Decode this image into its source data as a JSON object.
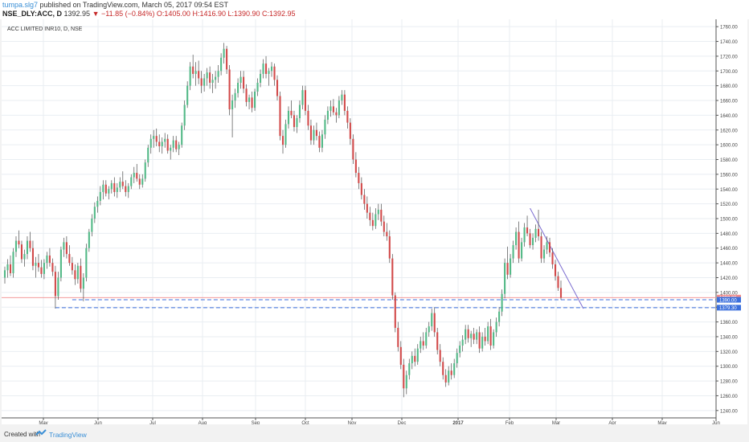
{
  "header": {
    "author": "tumpa.slg7",
    "published_text": "published on TradingView.com, March 05, 2017 09:54 EST",
    "symbol": "NSE_DLY:ACC, D",
    "last": "1392.95",
    "change": "▼ −11.85 (−0.84%)",
    "ohlc": "O:1405.00 H:1416.90 L:1390.90 C:1392.95"
  },
  "footer": {
    "created_with": "Created with",
    "brand": "TradingView"
  },
  "chart_data": {
    "type": "candlestick",
    "title": "ACC LIMITED INR10, D, NSE",
    "y_axis": {
      "min": 1230,
      "max": 1770,
      "ticks": [
        1240,
        1260,
        1280,
        1300,
        1320,
        1340,
        1360,
        1380,
        1400,
        1420,
        1440,
        1460,
        1480,
        1500,
        1520,
        1540,
        1560,
        1580,
        1600,
        1620,
        1640,
        1660,
        1680,
        1700,
        1720,
        1740,
        1760
      ],
      "tick_labels": [
        "1240.00",
        "1260.00",
        "1280.00",
        "1300.00",
        "1320.00",
        "1340.00",
        "1360.00",
        "1380.00",
        "1400.00",
        "1420.00",
        "1440.00",
        "1460.00",
        "1480.00",
        "1500.00",
        "1520.00",
        "1540.00",
        "1560.00",
        "1580.00",
        "1600.00",
        "1620.00",
        "1640.00",
        "1660.00",
        "1680.00",
        "1700.00",
        "1720.00",
        "1740.00",
        "1760.00"
      ]
    },
    "x_axis": {
      "labels": [
        "May",
        "Jun",
        "Jul",
        "Aug",
        "Sep",
        "Oct",
        "Nov",
        "Dec",
        "2017",
        "Feb",
        "Mar",
        "Apr",
        "May",
        "Jun"
      ],
      "bold": "2017"
    },
    "grid": true,
    "colors": {
      "up": "#53b987",
      "down": "#d24a4a",
      "wick": "#4d4d4d",
      "grid": "#e9eef2",
      "trendline": "#7b6cd0",
      "level": "#3b6fdc",
      "last_price": "#f28b8b"
    },
    "candles": [
      [
        1420,
        1435,
        1412,
        1430
      ],
      [
        1430,
        1445,
        1420,
        1438
      ],
      [
        1438,
        1450,
        1422,
        1426
      ],
      [
        1426,
        1460,
        1420,
        1455
      ],
      [
        1455,
        1476,
        1448,
        1470
      ],
      [
        1470,
        1484,
        1460,
        1465
      ],
      [
        1465,
        1470,
        1440,
        1445
      ],
      [
        1445,
        1458,
        1435,
        1452
      ],
      [
        1452,
        1476,
        1445,
        1470
      ],
      [
        1470,
        1482,
        1455,
        1460
      ],
      [
        1460,
        1470,
        1430,
        1436
      ],
      [
        1436,
        1448,
        1420,
        1440
      ],
      [
        1440,
        1452,
        1428,
        1434
      ],
      [
        1434,
        1444,
        1420,
        1425
      ],
      [
        1425,
        1445,
        1418,
        1440
      ],
      [
        1440,
        1455,
        1432,
        1450
      ],
      [
        1450,
        1460,
        1435,
        1440
      ],
      [
        1440,
        1446,
        1422,
        1428
      ],
      [
        1428,
        1436,
        1378,
        1395
      ],
      [
        1395,
        1428,
        1390,
        1420
      ],
      [
        1420,
        1462,
        1415,
        1458
      ],
      [
        1458,
        1474,
        1448,
        1468
      ],
      [
        1468,
        1476,
        1446,
        1452
      ],
      [
        1452,
        1464,
        1436,
        1440
      ],
      [
        1440,
        1448,
        1424,
        1430
      ],
      [
        1430,
        1438,
        1410,
        1418
      ],
      [
        1418,
        1440,
        1412,
        1436
      ],
      [
        1436,
        1446,
        1400,
        1405
      ],
      [
        1405,
        1426,
        1388,
        1420
      ],
      [
        1420,
        1466,
        1415,
        1460
      ],
      [
        1460,
        1486,
        1455,
        1482
      ],
      [
        1482,
        1506,
        1476,
        1500
      ],
      [
        1500,
        1522,
        1494,
        1516
      ],
      [
        1516,
        1530,
        1508,
        1524
      ],
      [
        1524,
        1544,
        1518,
        1536
      ],
      [
        1536,
        1552,
        1526,
        1546
      ],
      [
        1546,
        1552,
        1530,
        1534
      ],
      [
        1534,
        1544,
        1526,
        1540
      ],
      [
        1540,
        1552,
        1534,
        1548
      ],
      [
        1548,
        1556,
        1530,
        1536
      ],
      [
        1536,
        1548,
        1528,
        1542
      ],
      [
        1542,
        1556,
        1536,
        1550
      ],
      [
        1550,
        1564,
        1540,
        1544
      ],
      [
        1544,
        1552,
        1530,
        1536
      ],
      [
        1536,
        1548,
        1528,
        1544
      ],
      [
        1544,
        1560,
        1540,
        1556
      ],
      [
        1556,
        1570,
        1548,
        1562
      ],
      [
        1562,
        1574,
        1550,
        1554
      ],
      [
        1554,
        1560,
        1540,
        1546
      ],
      [
        1546,
        1560,
        1542,
        1554
      ],
      [
        1554,
        1580,
        1550,
        1576
      ],
      [
        1576,
        1600,
        1570,
        1596
      ],
      [
        1596,
        1614,
        1588,
        1608
      ],
      [
        1608,
        1620,
        1596,
        1612
      ],
      [
        1612,
        1622,
        1598,
        1604
      ],
      [
        1604,
        1614,
        1590,
        1598
      ],
      [
        1598,
        1610,
        1588,
        1604
      ],
      [
        1604,
        1616,
        1596,
        1608
      ],
      [
        1608,
        1614,
        1588,
        1592
      ],
      [
        1592,
        1600,
        1580,
        1596
      ],
      [
        1596,
        1612,
        1590,
        1606
      ],
      [
        1606,
        1612,
        1590,
        1594
      ],
      [
        1594,
        1604,
        1586,
        1600
      ],
      [
        1600,
        1630,
        1596,
        1626
      ],
      [
        1626,
        1660,
        1620,
        1654
      ],
      [
        1654,
        1686,
        1650,
        1680
      ],
      [
        1680,
        1712,
        1674,
        1706
      ],
      [
        1706,
        1722,
        1690,
        1696
      ],
      [
        1696,
        1712,
        1680,
        1700
      ],
      [
        1700,
        1714,
        1682,
        1690
      ],
      [
        1690,
        1700,
        1670,
        1680
      ],
      [
        1680,
        1696,
        1672,
        1690
      ],
      [
        1690,
        1704,
        1680,
        1698
      ],
      [
        1698,
        1706,
        1676,
        1684
      ],
      [
        1684,
        1696,
        1670,
        1688
      ],
      [
        1688,
        1700,
        1676,
        1692
      ],
      [
        1692,
        1708,
        1684,
        1700
      ],
      [
        1700,
        1724,
        1694,
        1718
      ],
      [
        1718,
        1738,
        1710,
        1730
      ],
      [
        1730,
        1734,
        1696,
        1702
      ],
      [
        1702,
        1708,
        1640,
        1648
      ],
      [
        1648,
        1668,
        1610,
        1660
      ],
      [
        1660,
        1676,
        1650,
        1670
      ],
      [
        1670,
        1690,
        1664,
        1684
      ],
      [
        1684,
        1700,
        1676,
        1692
      ],
      [
        1692,
        1700,
        1670,
        1676
      ],
      [
        1676,
        1682,
        1652,
        1658
      ],
      [
        1658,
        1668,
        1648,
        1664
      ],
      [
        1664,
        1672,
        1644,
        1650
      ],
      [
        1650,
        1676,
        1646,
        1672
      ],
      [
        1672,
        1690,
        1666,
        1684
      ],
      [
        1684,
        1702,
        1678,
        1696
      ],
      [
        1696,
        1716,
        1690,
        1710
      ],
      [
        1710,
        1720,
        1690,
        1696
      ],
      [
        1696,
        1704,
        1680,
        1700
      ],
      [
        1700,
        1712,
        1692,
        1706
      ],
      [
        1706,
        1710,
        1680,
        1688
      ],
      [
        1688,
        1694,
        1660,
        1666
      ],
      [
        1666,
        1672,
        1606,
        1612
      ],
      [
        1612,
        1620,
        1588,
        1600
      ],
      [
        1600,
        1634,
        1596,
        1628
      ],
      [
        1628,
        1652,
        1622,
        1646
      ],
      [
        1646,
        1660,
        1636,
        1640
      ],
      [
        1640,
        1646,
        1618,
        1624
      ],
      [
        1624,
        1640,
        1616,
        1636
      ],
      [
        1636,
        1660,
        1630,
        1654
      ],
      [
        1654,
        1680,
        1648,
        1674
      ],
      [
        1674,
        1680,
        1640,
        1646
      ],
      [
        1646,
        1654,
        1620,
        1626
      ],
      [
        1626,
        1634,
        1600,
        1606
      ],
      [
        1606,
        1626,
        1600,
        1620
      ],
      [
        1620,
        1630,
        1606,
        1612
      ],
      [
        1612,
        1618,
        1590,
        1596
      ],
      [
        1596,
        1620,
        1590,
        1614
      ],
      [
        1614,
        1640,
        1608,
        1634
      ],
      [
        1634,
        1652,
        1628,
        1646
      ],
      [
        1646,
        1660,
        1638,
        1652
      ],
      [
        1652,
        1662,
        1640,
        1644
      ],
      [
        1644,
        1650,
        1630,
        1640
      ],
      [
        1640,
        1666,
        1636,
        1660
      ],
      [
        1660,
        1674,
        1654,
        1668
      ],
      [
        1668,
        1674,
        1640,
        1646
      ],
      [
        1646,
        1652,
        1622,
        1630
      ],
      [
        1630,
        1636,
        1600,
        1608
      ],
      [
        1608,
        1614,
        1574,
        1580
      ],
      [
        1580,
        1590,
        1556,
        1562
      ],
      [
        1562,
        1570,
        1540,
        1548
      ],
      [
        1548,
        1556,
        1526,
        1532
      ],
      [
        1532,
        1540,
        1512,
        1520
      ],
      [
        1520,
        1530,
        1500,
        1508
      ],
      [
        1508,
        1516,
        1490,
        1498
      ],
      [
        1498,
        1508,
        1484,
        1490
      ],
      [
        1490,
        1514,
        1486,
        1506
      ],
      [
        1506,
        1520,
        1498,
        1512
      ],
      [
        1512,
        1520,
        1490,
        1496
      ],
      [
        1496,
        1504,
        1476,
        1482
      ],
      [
        1482,
        1494,
        1470,
        1476
      ],
      [
        1476,
        1484,
        1440,
        1446
      ],
      [
        1446,
        1452,
        1390,
        1396
      ],
      [
        1396,
        1400,
        1346,
        1352
      ],
      [
        1352,
        1360,
        1320,
        1326
      ],
      [
        1326,
        1334,
        1296,
        1302
      ],
      [
        1302,
        1310,
        1258,
        1270
      ],
      [
        1270,
        1294,
        1262,
        1288
      ],
      [
        1288,
        1310,
        1282,
        1304
      ],
      [
        1304,
        1320,
        1296,
        1314
      ],
      [
        1314,
        1324,
        1300,
        1306
      ],
      [
        1306,
        1330,
        1302,
        1324
      ],
      [
        1324,
        1340,
        1318,
        1334
      ],
      [
        1334,
        1346,
        1322,
        1328
      ],
      [
        1328,
        1352,
        1324,
        1346
      ],
      [
        1346,
        1360,
        1340,
        1354
      ],
      [
        1354,
        1378,
        1348,
        1372
      ],
      [
        1372,
        1380,
        1340,
        1346
      ],
      [
        1346,
        1352,
        1316,
        1322
      ],
      [
        1322,
        1330,
        1300,
        1306
      ],
      [
        1306,
        1312,
        1282,
        1288
      ],
      [
        1288,
        1296,
        1272,
        1278
      ],
      [
        1278,
        1300,
        1274,
        1294
      ],
      [
        1294,
        1304,
        1282,
        1288
      ],
      [
        1288,
        1310,
        1284,
        1304
      ],
      [
        1304,
        1324,
        1298,
        1318
      ],
      [
        1318,
        1334,
        1312,
        1328
      ],
      [
        1328,
        1342,
        1320,
        1336
      ],
      [
        1336,
        1356,
        1330,
        1350
      ],
      [
        1350,
        1356,
        1332,
        1338
      ],
      [
        1338,
        1348,
        1326,
        1344
      ],
      [
        1344,
        1352,
        1330,
        1336
      ],
      [
        1336,
        1350,
        1330,
        1346
      ],
      [
        1346,
        1354,
        1318,
        1324
      ],
      [
        1324,
        1346,
        1320,
        1340
      ],
      [
        1340,
        1352,
        1328,
        1334
      ],
      [
        1334,
        1360,
        1330,
        1354
      ],
      [
        1354,
        1364,
        1322,
        1328
      ],
      [
        1328,
        1350,
        1324,
        1346
      ],
      [
        1346,
        1366,
        1340,
        1360
      ],
      [
        1360,
        1380,
        1354,
        1374
      ],
      [
        1374,
        1404,
        1368,
        1398
      ],
      [
        1398,
        1446,
        1392,
        1440
      ],
      [
        1440,
        1462,
        1418,
        1424
      ],
      [
        1424,
        1452,
        1420,
        1446
      ],
      [
        1446,
        1470,
        1440,
        1464
      ],
      [
        1464,
        1488,
        1458,
        1482
      ],
      [
        1482,
        1496,
        1440,
        1446
      ],
      [
        1446,
        1474,
        1442,
        1468
      ],
      [
        1468,
        1494,
        1462,
        1488
      ],
      [
        1488,
        1504,
        1476,
        1480
      ],
      [
        1480,
        1486,
        1460,
        1464
      ],
      [
        1464,
        1480,
        1458,
        1474
      ],
      [
        1474,
        1492,
        1468,
        1486
      ],
      [
        1486,
        1512,
        1470,
        1476
      ],
      [
        1476,
        1482,
        1440,
        1446
      ],
      [
        1446,
        1464,
        1440,
        1458
      ],
      [
        1458,
        1476,
        1452,
        1468
      ],
      [
        1468,
        1474,
        1448,
        1454
      ],
      [
        1454,
        1460,
        1432,
        1438
      ],
      [
        1438,
        1444,
        1416,
        1422
      ],
      [
        1422,
        1428,
        1402,
        1406
      ],
      [
        1406,
        1416,
        1390,
        1392.95
      ]
    ],
    "trendline": {
      "from": [
        187,
        1514
      ],
      "to": [
        206,
        1378
      ]
    },
    "levels": [
      {
        "value": 1390.0,
        "label": "1390.00",
        "from_index": 24
      },
      {
        "value": 1379.3,
        "label": "1379.30",
        "from_index": 18
      }
    ],
    "last_price": {
      "value": 1392.95,
      "label": "1392.95"
    }
  }
}
